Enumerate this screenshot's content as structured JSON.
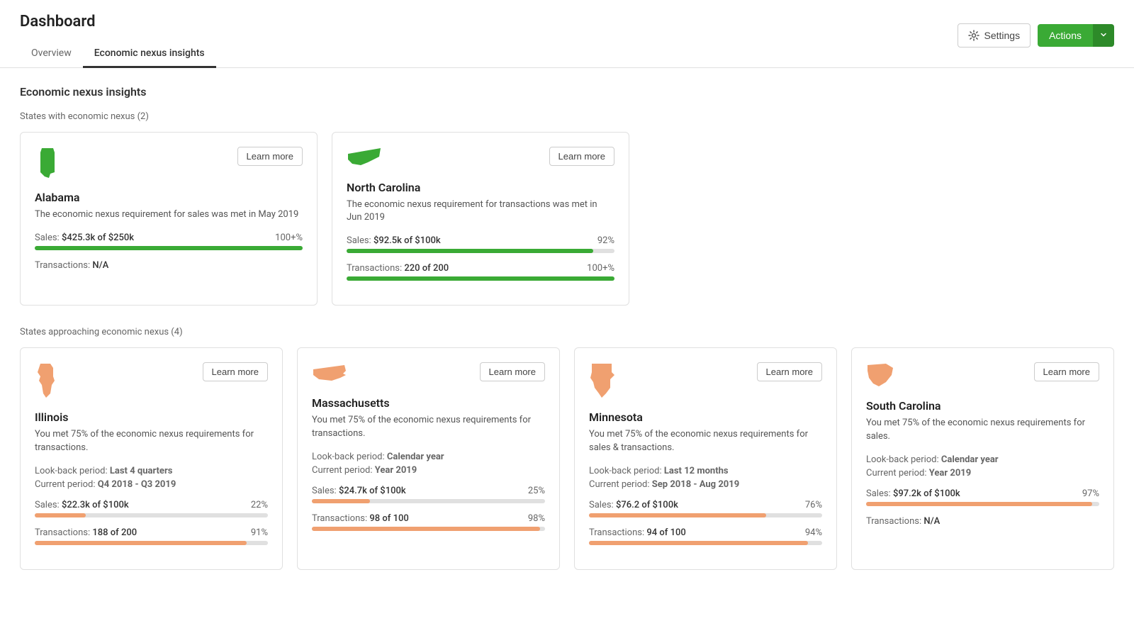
{
  "header": {
    "title": "Dashboard",
    "tabs": [
      {
        "id": "overview",
        "label": "Overview",
        "active": false
      },
      {
        "id": "economic-nexus",
        "label": "Economic nexus insights",
        "active": true
      }
    ],
    "settings_label": "Settings",
    "actions_label": "Actions"
  },
  "page": {
    "section_title": "Economic nexus insights",
    "states_with_nexus_title": "States with economic nexus (2)",
    "states_approaching_title": "States approaching economic nexus (4)",
    "learn_more_label": "Learn more"
  },
  "states_with_nexus": [
    {
      "name": "Alabama",
      "description": "The economic nexus requirement for sales was met in May 2019",
      "state_code": "AL",
      "color": "#3aaa35",
      "sales_label": "Sales:",
      "sales_value": "$425.3k of $250k",
      "sales_pct_label": "100+%",
      "sales_pct": 100,
      "transactions_label": "Transactions:",
      "transactions_value": "N/A",
      "transactions_pct_label": "",
      "transactions_pct": 0
    },
    {
      "name": "North Carolina",
      "description": "The economic nexus requirement for transactions was met in Jun 2019",
      "state_code": "NC",
      "color": "#3aaa35",
      "sales_label": "Sales:",
      "sales_value": "$92.5k of $100k",
      "sales_pct_label": "92%",
      "sales_pct": 92,
      "transactions_label": "Transactions:",
      "transactions_value": "220 of 200",
      "transactions_pct_label": "100+%",
      "transactions_pct": 100
    }
  ],
  "states_approaching": [
    {
      "name": "Illinois",
      "description": "You met 75% of the economic nexus requirements for transactions.",
      "state_code": "IL",
      "color": "#f0a070",
      "lookback_label": "Look-back period:",
      "lookback_value": "Last 4 quarters",
      "current_period_label": "Current period:",
      "current_period_value": "Q4 2018 - Q3 2019",
      "sales_label": "Sales:",
      "sales_value": "$22.3k of $100k",
      "sales_pct_label": "22%",
      "sales_pct": 22,
      "transactions_label": "Transactions:",
      "transactions_value": "188 of 200",
      "transactions_pct_label": "91%",
      "transactions_pct": 91
    },
    {
      "name": "Massachusetts",
      "description": "You met 75% of the economic nexus requirements for transactions.",
      "state_code": "MA",
      "color": "#f0a070",
      "lookback_label": "Look-back period:",
      "lookback_value": "Calendar year",
      "current_period_label": "Current period:",
      "current_period_value": "Year 2019",
      "sales_label": "Sales:",
      "sales_value": "$24.7k of $100k",
      "sales_pct_label": "25%",
      "sales_pct": 25,
      "transactions_label": "Transactions:",
      "transactions_value": "98 of 100",
      "transactions_pct_label": "98%",
      "transactions_pct": 98
    },
    {
      "name": "Minnesota",
      "description": "You met 75% of the economic nexus requirements for sales & transactions.",
      "state_code": "MN",
      "color": "#f0a070",
      "lookback_label": "Look-back period:",
      "lookback_value": "Last 12 months",
      "current_period_label": "Current period:",
      "current_period_value": "Sep 2018 - Aug 2019",
      "sales_label": "Sales:",
      "sales_value": "$76.2 of $100k",
      "sales_pct_label": "76%",
      "sales_pct": 76,
      "transactions_label": "Transactions:",
      "transactions_value": "94 of 100",
      "transactions_pct_label": "94%",
      "transactions_pct": 94
    },
    {
      "name": "South Carolina",
      "description": "You met 75% of the economic nexus requirements for sales.",
      "state_code": "SC",
      "color": "#f0a070",
      "lookback_label": "Look-back period:",
      "lookback_value": "Calendar year",
      "current_period_label": "Current period:",
      "current_period_value": "Year 2019",
      "sales_label": "Sales:",
      "sales_value": "$97.2k of $100k",
      "sales_pct_label": "97%",
      "sales_pct": 97,
      "transactions_label": "Transactions:",
      "transactions_value": "N/A",
      "transactions_pct_label": "",
      "transactions_pct": 0
    }
  ]
}
